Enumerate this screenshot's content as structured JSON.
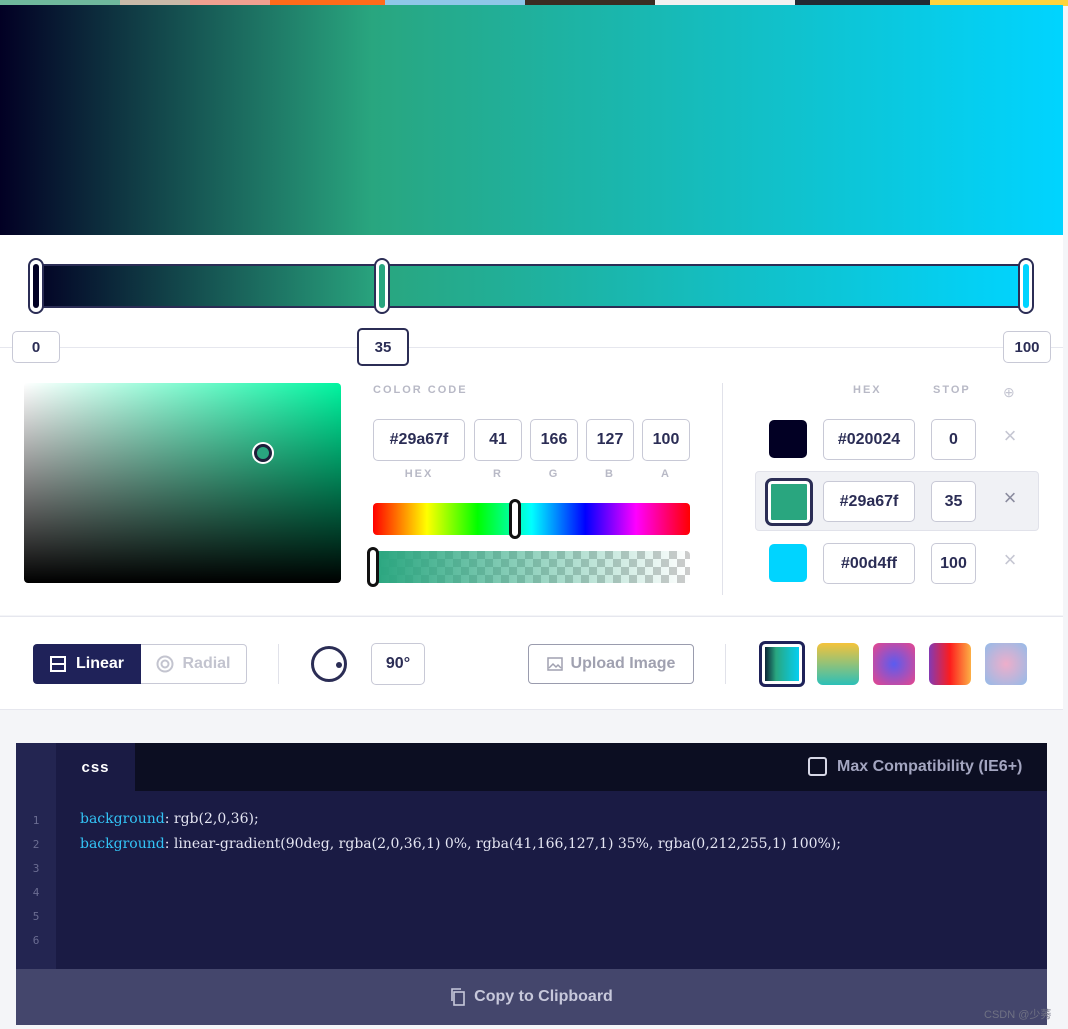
{
  "gradient": {
    "css": "linear-gradient(90deg, #020024 0%, #29a67f 35%, #00d4ff 100%)",
    "stops": [
      {
        "hex": "#020024",
        "stop": "0",
        "color": "#020024",
        "remove_icon": "×"
      },
      {
        "hex": "#29a67f",
        "stop": "35",
        "color": "#29a67f",
        "remove_icon": "×"
      },
      {
        "hex": "#00d4ff",
        "stop": "100",
        "color": "#00d4ff",
        "remove_icon": "×"
      }
    ]
  },
  "color_picker": {
    "section_label": "COLOR CODE",
    "hex_value": "#29a67f",
    "r_value": "41",
    "g_value": "166",
    "b_value": "127",
    "a_value": "100",
    "hex_label": "HEX",
    "r_label": "R",
    "g_label": "G",
    "b_label": "B",
    "a_label": "A"
  },
  "stops_panel": {
    "hex_header": "HEX",
    "stop_header": "STOP",
    "add_icon": "⊕"
  },
  "controls": {
    "linear_label": "Linear",
    "radial_label": "Radial",
    "angle_value": "90°",
    "upload_label": "Upload Image",
    "presets": [
      "linear-gradient(90deg, #020024, #29a67f 35%, #00d4ff)",
      "linear-gradient(180deg, #f5c33b, #2cc0b8)",
      "radial-gradient(circle, #5a5cf0, #e8468c)",
      "linear-gradient(90deg, #833ab4, #fd1d1d 50%, #fcb045)",
      "radial-gradient(circle, #eeaeca, #94bbe9)"
    ]
  },
  "code": {
    "tab_label": "css",
    "compat_label": "Max Compatibility (IE6+)",
    "line_numbers": [
      "1",
      "2",
      "3",
      "4",
      "5",
      "6"
    ],
    "line1_prop": "background",
    "line1_value": ": rgb(2,0,36);",
    "line2_prop": "background",
    "line2_value": ": linear-gradient(90deg, rgba(2,0,36,1) 0%, rgba(41,166,127,1) 35%, rgba(0,212,255,1) 100%);",
    "copy_label": "Copy to Clipboard"
  },
  "watermark": "CSDN @少莠"
}
